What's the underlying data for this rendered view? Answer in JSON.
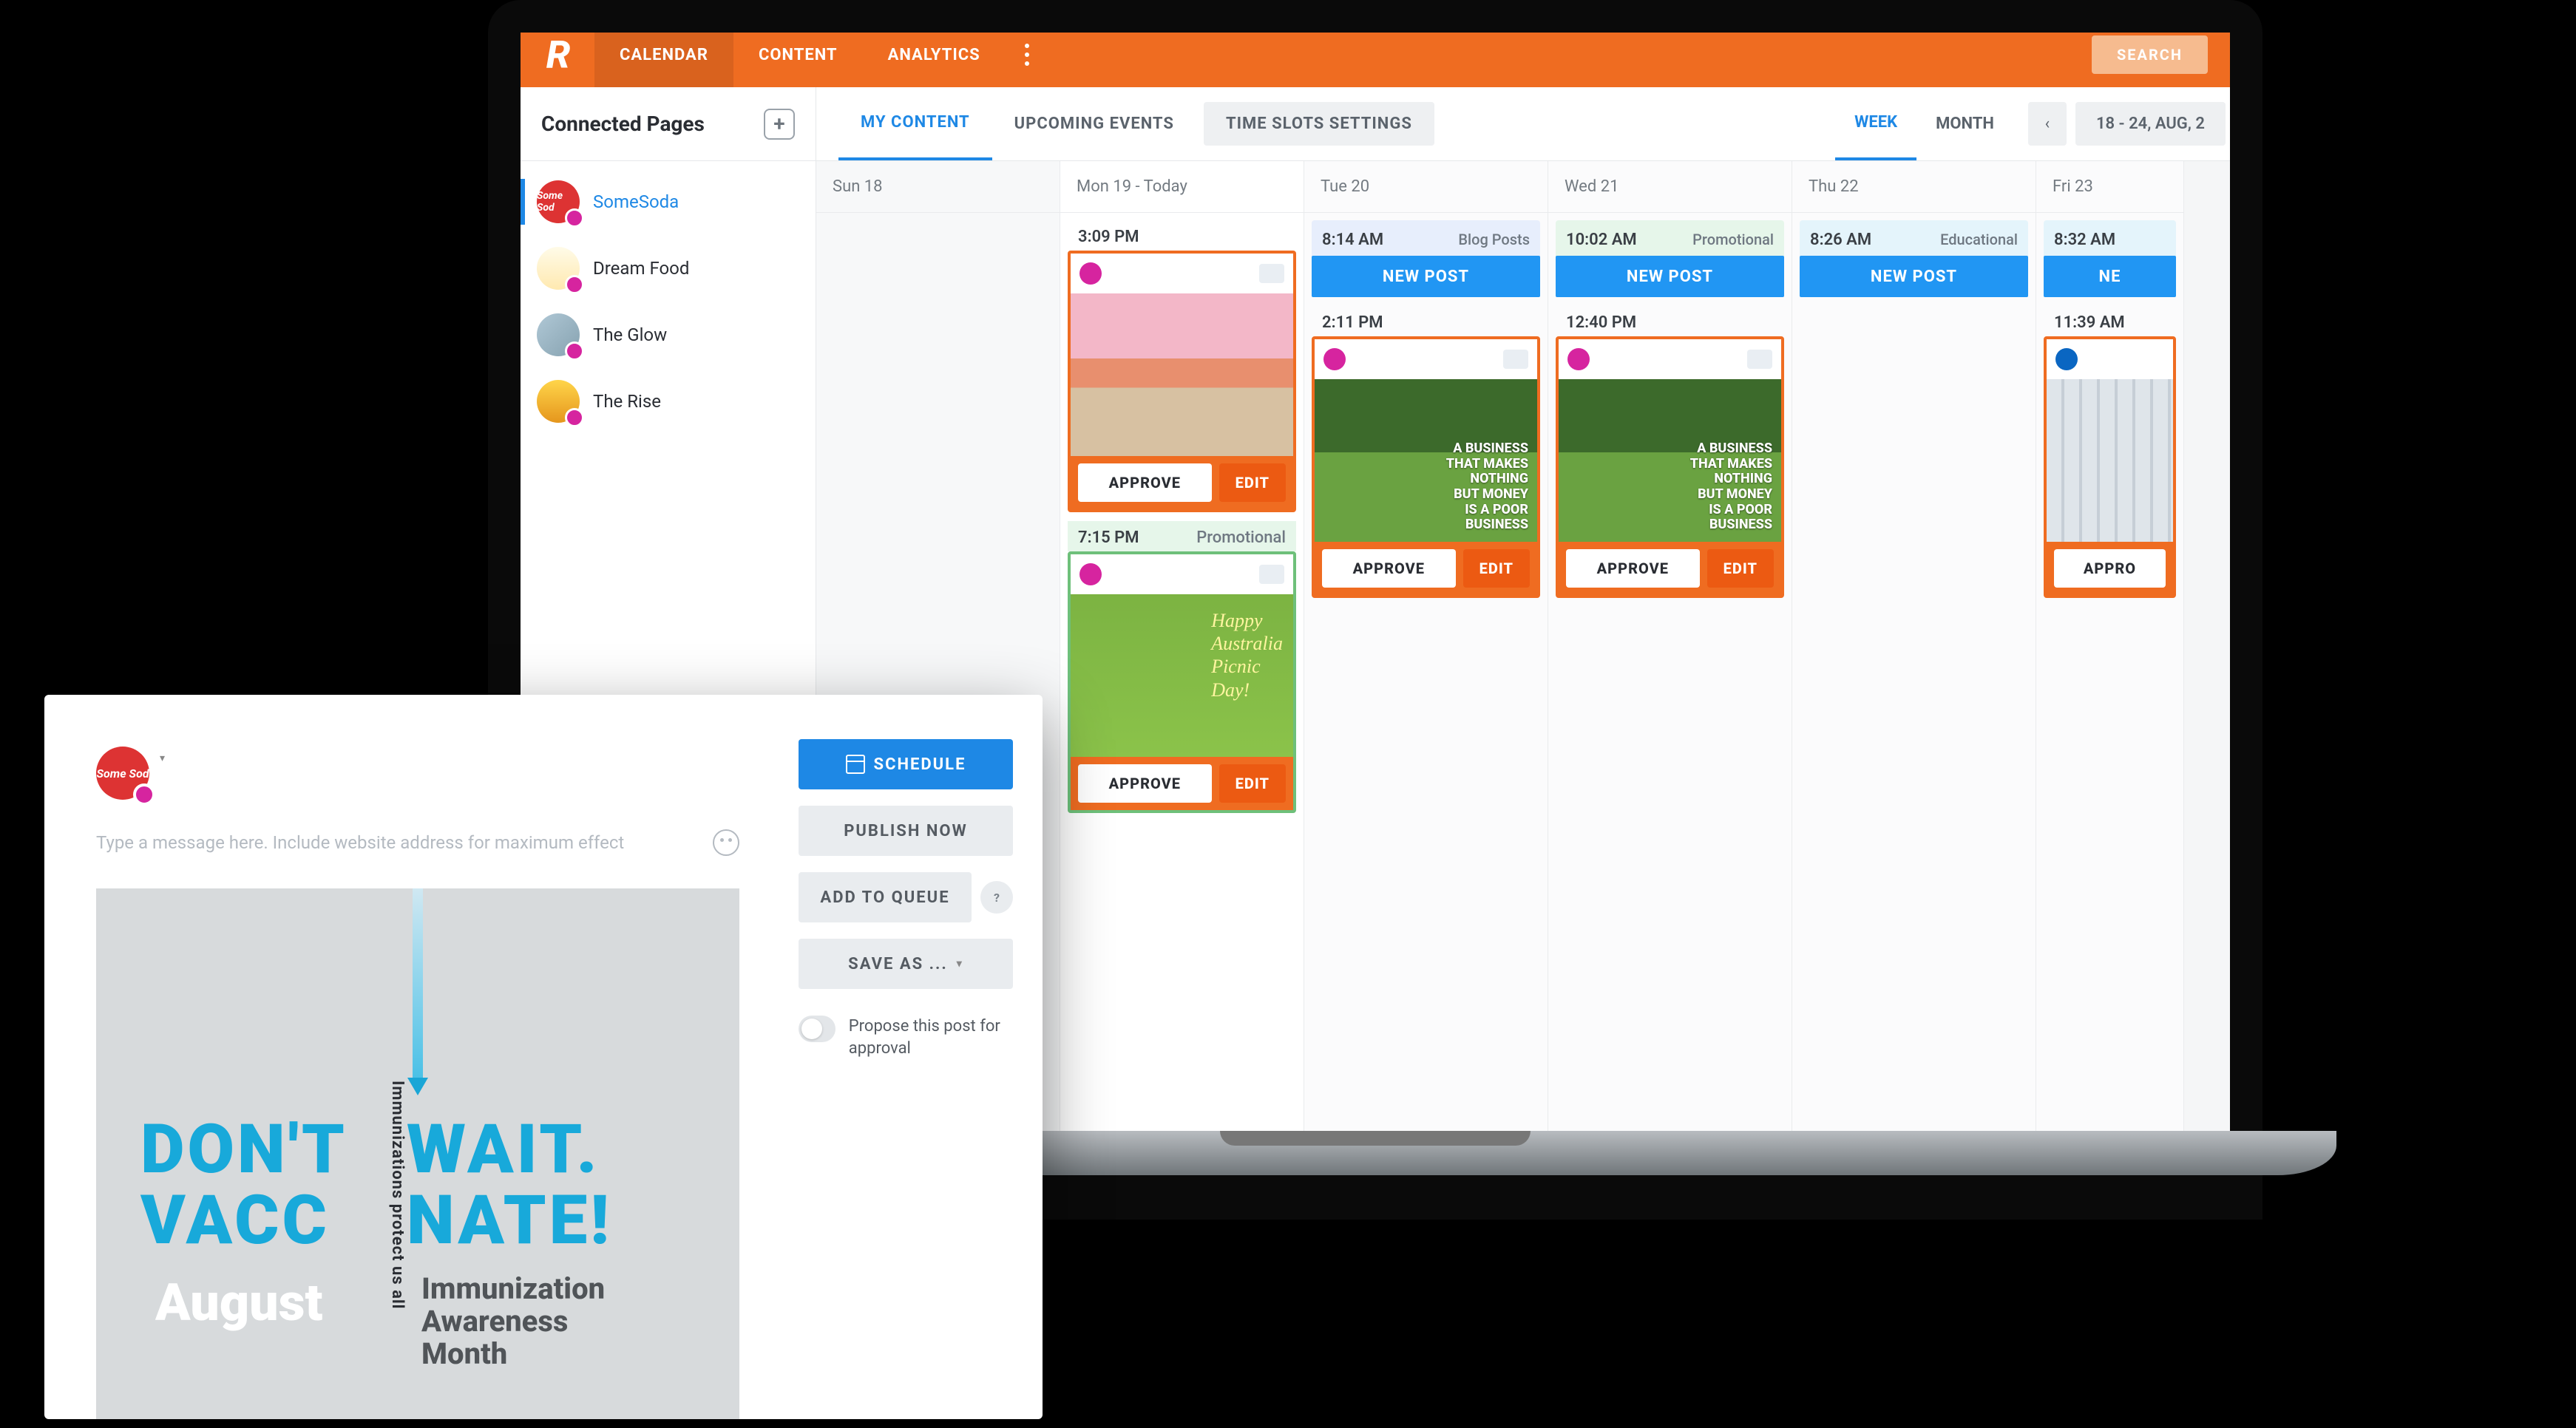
{
  "topbar": {
    "tabs": [
      "CALENDAR",
      "CONTENT",
      "ANALYTICS"
    ],
    "search": "SEARCH"
  },
  "sidebar": {
    "title": "Connected Pages",
    "pages": [
      {
        "name": "SomeSoda",
        "avatar_text": "Some Sod"
      },
      {
        "name": "Dream Food"
      },
      {
        "name": "The Glow"
      },
      {
        "name": "The Rise"
      }
    ]
  },
  "subbar": {
    "tabs": [
      "MY CONTENT",
      "UPCOMING EVENTS",
      "TIME SLOTS SETTINGS"
    ],
    "range": [
      "WEEK",
      "MONTH"
    ],
    "date": "18 - 24, AUG, 2"
  },
  "labels": {
    "new_post": "NEW POST",
    "approve": "APPROVE",
    "edit": "EDIT"
  },
  "tags": {
    "blog": "Blog Posts",
    "promo": "Promotional",
    "edu": "Educational"
  },
  "days": {
    "sun": "Sun 18",
    "mon": "Mon 19 - Today",
    "tue": "Tue 20",
    "wed": "Wed 21",
    "thu": "Thu 22",
    "fri": "Fri 23"
  },
  "mon": {
    "slot1_time": "3:09 PM",
    "slot2_time": "7:15 PM",
    "picnic_text": "Happy\nAustralia\nPicnic\nDay!"
  },
  "tue": {
    "slot1_time": "8:14 AM",
    "slot2_time": "2:11 PM",
    "biz_text": "A BUSINESS\nTHAT MAKES\nNOTHING\nBUT MONEY\nIS A POOR\nBUSINESS"
  },
  "wed": {
    "slot1_time": "10:02 AM",
    "slot2_time": "12:40 PM"
  },
  "thu": {
    "slot1_time": "8:26 AM"
  },
  "fri": {
    "slot1_time": "8:32 AM",
    "slot1_btn": "NE",
    "slot2_time": "11:39 AM",
    "approve_trunc": "APPRO"
  },
  "composer": {
    "avatar_text": "Some Sod",
    "placeholder": "Type a message here. Include website address for maximum effect",
    "img": {
      "line1a": "DON'T",
      "line1b": "WAIT.",
      "line2a": "VACC",
      "line2b": "NATE!",
      "month": "August",
      "sub": "Immunization\nAwareness\nMonth",
      "vert": "Immunizations protect us all"
    },
    "buttons": {
      "schedule": "SCHEDULE",
      "publish": "PUBLISH NOW",
      "queue": "ADD TO QUEUE",
      "save": "SAVE AS ..."
    },
    "propose": "Propose this post for approval"
  }
}
